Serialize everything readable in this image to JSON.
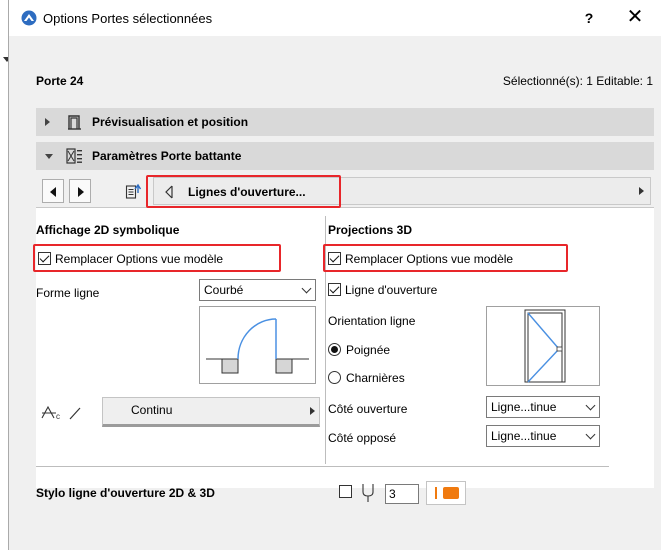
{
  "window": {
    "title": "Options Portes sélectionnées",
    "help_label": "?",
    "close_label": "✕"
  },
  "header": {
    "element_name": "Porte 24",
    "selection_info": "Sélectionné(s): 1 Editable: 1"
  },
  "sections": {
    "preview_position": "Prévisualisation et position",
    "door_params": "Paramètres Porte battante"
  },
  "navigator": {
    "current_panel": "Lignes d'ouverture..."
  },
  "symbolic_2d": {
    "heading": "Affichage 2D symbolique",
    "override_label": "Remplacer Options vue modèle",
    "override_checked": true,
    "line_shape_label": "Forme ligne",
    "line_shape_value": "Courbé",
    "line_type_value": "Continu"
  },
  "projections_3d": {
    "heading": "Projections 3D",
    "override_label": "Remplacer Options vue modèle",
    "override_checked": true,
    "opening_line_label": "Ligne d'ouverture",
    "opening_line_checked": true,
    "orientation_label": "Orientation ligne",
    "options": [
      "Poignée",
      "Charnières"
    ],
    "selected_option": "Poignée",
    "opening_side_label": "Côté ouverture",
    "opening_side_value": "Ligne...tinue",
    "opposite_side_label": "Côté opposé",
    "opposite_side_value": "Ligne...tinue"
  },
  "footer": {
    "pen_label": "Stylo ligne d'ouverture 2D & 3D",
    "pen_number": "3",
    "pen_color": "#f07a0f"
  },
  "colors": {
    "highlight": "#e8262a",
    "title_icon": "#2d6cc0",
    "preview_line": "#4a90e2"
  }
}
